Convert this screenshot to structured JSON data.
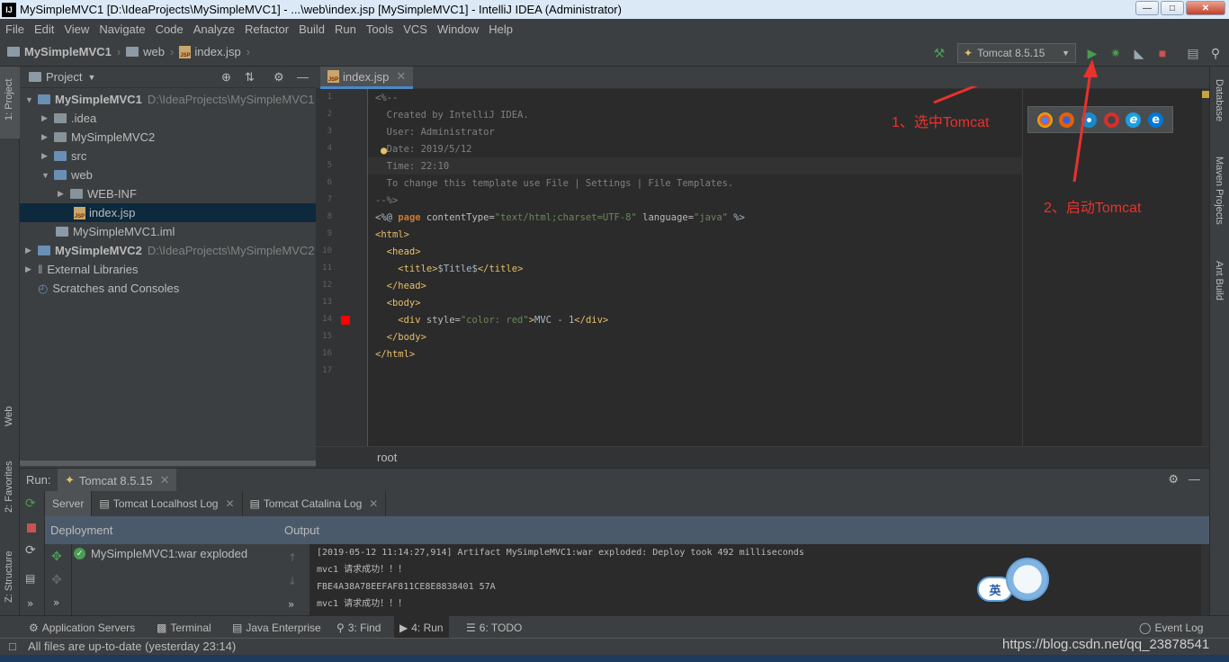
{
  "window": {
    "title": "MySimpleMVC1 [D:\\IdeaProjects\\MySimpleMVC1] - ...\\web\\index.jsp [MySimpleMVC1] - IntelliJ IDEA (Administrator)",
    "logo": "IJ"
  },
  "menu": [
    "File",
    "Edit",
    "View",
    "Navigate",
    "Code",
    "Analyze",
    "Refactor",
    "Build",
    "Run",
    "Tools",
    "VCS",
    "Window",
    "Help"
  ],
  "nav": {
    "project": "MySimpleMVC1",
    "folder": "web",
    "file": "index.jsp"
  },
  "toolbar": {
    "run_config": "Tomcat 8.5.15",
    "icons": [
      "hammer-icon",
      "run-icon",
      "debug-icon",
      "coverage-icon",
      "stop-icon",
      "project-structure-icon",
      "search-icon"
    ]
  },
  "left_stripe": {
    "project": "1: Project",
    "web": "Web",
    "favorites": "2: Favorites",
    "structure": "Z: Structure"
  },
  "project_panel": {
    "title": "Project",
    "tree": [
      {
        "label": "MySimpleMVC1",
        "path": "D:\\IdeaProjects\\MySimpleMVC1",
        "bold": true
      },
      {
        "label": ".idea"
      },
      {
        "label": "MySimpleMVC2"
      },
      {
        "label": "src"
      },
      {
        "label": "web"
      },
      {
        "label": "WEB-INF"
      },
      {
        "label": "index.jsp"
      },
      {
        "label": "MySimpleMVC1.iml"
      },
      {
        "label": "MySimpleMVC2",
        "path": "D:\\IdeaProjects\\MySimpleMVC2",
        "bold": true
      },
      {
        "label": "External Libraries"
      },
      {
        "label": "Scratches and Consoles"
      }
    ]
  },
  "editor": {
    "tab": "index.jsp",
    "breadcrumb": "root",
    "line_numbers": [
      "1",
      "2",
      "3",
      "4",
      "5",
      "6",
      "7",
      "8",
      "9",
      "10",
      "11",
      "12",
      "13",
      "14",
      "15",
      "16",
      "17"
    ],
    "lines": {
      "l1": "<%--",
      "l2": "  Created by IntelliJ IDEA.",
      "l3": "  User: Administrator",
      "l4": "  Date: 2019/5/12",
      "l5": "  Time: 22:10",
      "l6": "  To change this template use File | Settings | File Templates.",
      "l7": "--%>",
      "l8_a": "<%@ ",
      "l8_b": "page ",
      "l8_c": "contentType=",
      "l8_d": "\"text/html;charset=UTF-8\"",
      "l8_e": " language=",
      "l8_f": "\"java\"",
      "l8_g": " %>",
      "l9": "<html>",
      "l10": "  <head>",
      "l11_a": "    <title>",
      "l11_b": "$Title$",
      "l11_c": "</title>",
      "l12": "  </head>",
      "l13": "  <body>",
      "l14_a": "    <div ",
      "l14_b": "style=",
      "l14_c": "\"color: red\"",
      "l14_d": ">",
      "l14_e": "MVC - 1",
      "l14_f": "</div>",
      "l15": "  </body>",
      "l16": "</html>"
    }
  },
  "annotations": {
    "select": "1、选中Tomcat",
    "start": "2、启动Tomcat"
  },
  "right_stripe": {
    "database": "Database",
    "maven": "Maven Projects",
    "ant": "Ant Build"
  },
  "run_panel": {
    "label": "Run:",
    "config": "Tomcat 8.5.15",
    "tabs": [
      "Server",
      "Tomcat Localhost Log",
      "Tomcat Catalina Log"
    ],
    "deployment_header": "Deployment",
    "output_header": "Output",
    "deployment_item": "MySimpleMVC1:war exploded",
    "output_lines": [
      "[2019-05-12 11:14:27,914] Artifact MySimpleMVC1:war exploded: Deploy took 492 milliseconds",
      "mvc1 请求成功！！！",
      "FBE4A38A78EEFAF811CE8E8838401 57A",
      "mvc1 请求成功！！！"
    ]
  },
  "bottom_tools": [
    {
      "label": "Application Servers"
    },
    {
      "label": "Terminal"
    },
    {
      "label": "Java Enterprise"
    },
    {
      "label": "3: Find"
    },
    {
      "label": "4: Run"
    },
    {
      "label": "6: TODO"
    },
    {
      "label": "Event Log"
    }
  ],
  "status": {
    "message": "All files are up-to-date (yesterday 23:14)",
    "watermark": "https://blog.csdn.net/qq_23878541",
    "ime": "英"
  },
  "colors": {
    "accent": "#4a88c7",
    "annotation": "#e8322d",
    "run_green": "#499c54",
    "stop_red": "#c75450"
  }
}
